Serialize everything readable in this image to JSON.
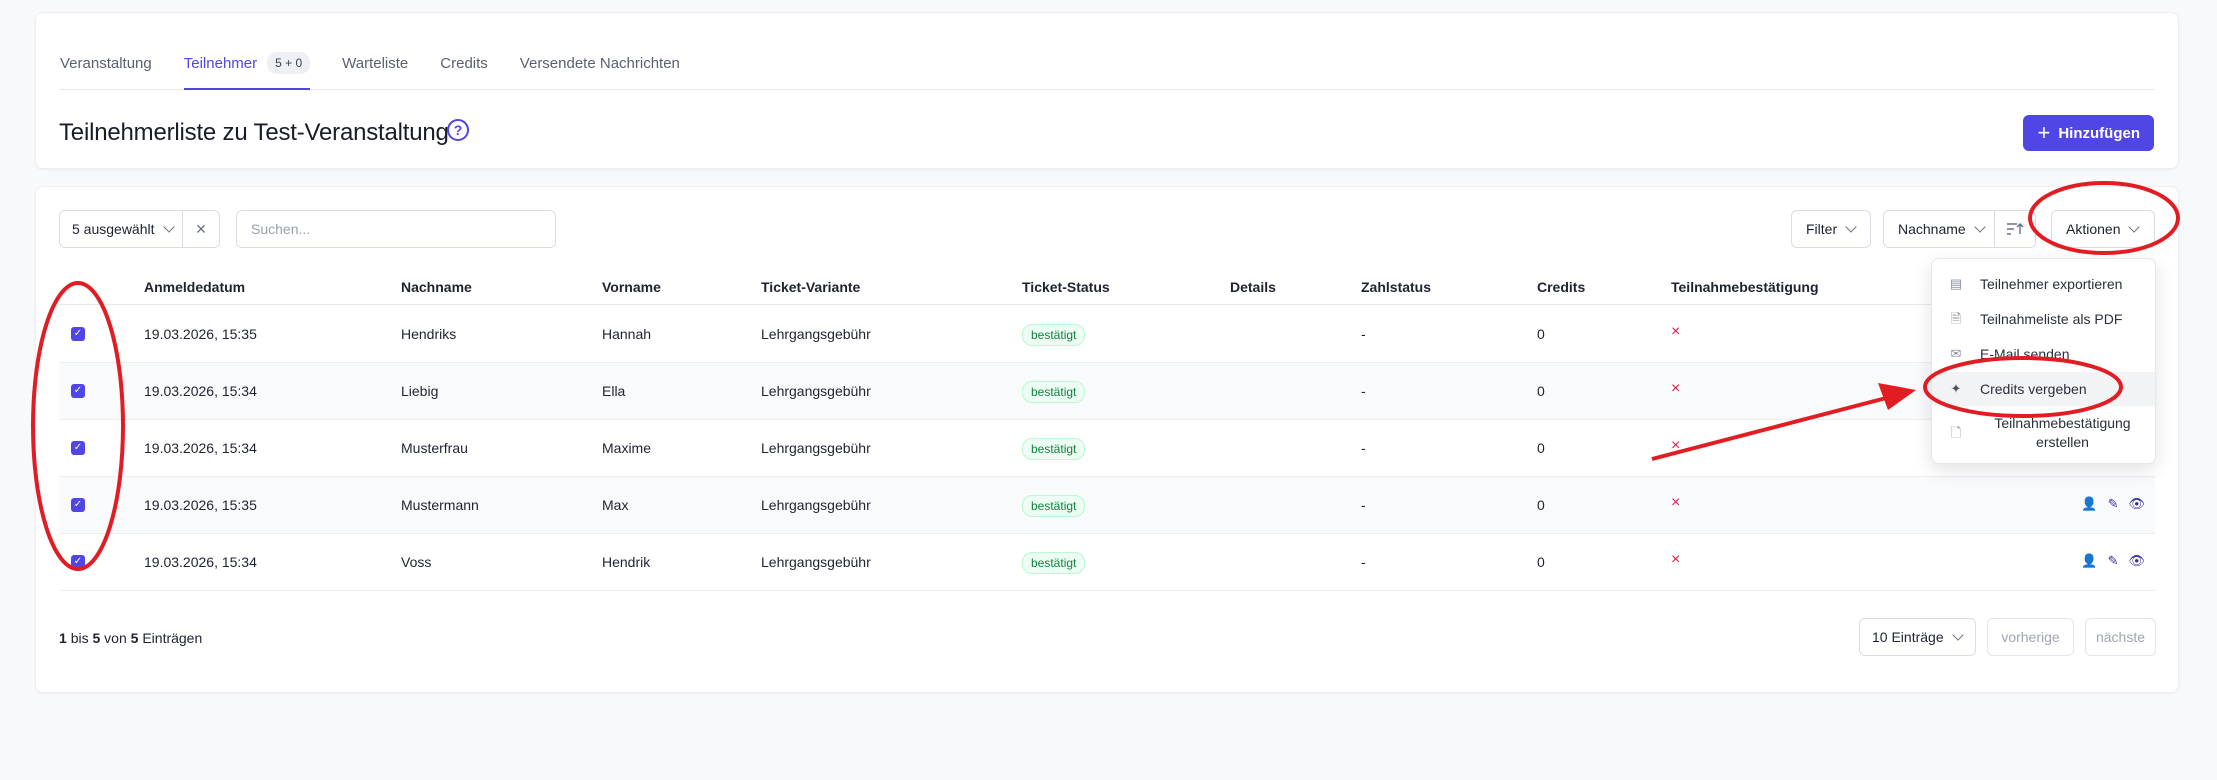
{
  "tabs": [
    {
      "label": "Veranstaltung"
    },
    {
      "label": "Teilnehmer",
      "badge": "5 + 0",
      "active": true
    },
    {
      "label": "Warteliste"
    },
    {
      "label": "Credits"
    },
    {
      "label": "Versendete Nachrichten"
    }
  ],
  "header": {
    "title": "Teilnehmerliste zu Test-Veranstaltung",
    "help_icon": "?",
    "add_button": "Hinzufügen"
  },
  "toolbar": {
    "selected": "5 ausgewählt",
    "search_placeholder": "Suchen...",
    "filter": "Filter",
    "sort": "Nachname",
    "actions": "Aktionen"
  },
  "table": {
    "columns": [
      "Anmeldedatum",
      "Nachname",
      "Vorname",
      "Ticket-Variante",
      "Ticket-Status",
      "Details",
      "Zahlstatus",
      "Credits",
      "Teilnahmebestätigung"
    ],
    "rows": [
      {
        "date": "19.03.2026, 15:35",
        "last": "Hendriks",
        "first": "Hannah",
        "ticket": "Lehrgangsgebühr",
        "status": "bestätigt",
        "pay": "-",
        "credits": "0",
        "confirm": "×"
      },
      {
        "date": "19.03.2026, 15:34",
        "last": "Liebig",
        "first": "Ella",
        "ticket": "Lehrgangsgebühr",
        "status": "bestätigt",
        "pay": "-",
        "credits": "0",
        "confirm": "×"
      },
      {
        "date": "19.03.2026, 15:34",
        "last": "Musterfrau",
        "first": "Maxime",
        "ticket": "Lehrgangsgebühr",
        "status": "bestätigt",
        "pay": "-",
        "credits": "0",
        "confirm": "×"
      },
      {
        "date": "19.03.2026, 15:35",
        "last": "Mustermann",
        "first": "Max",
        "ticket": "Lehrgangsgebühr",
        "status": "bestätigt",
        "pay": "-",
        "credits": "0",
        "confirm": "×"
      },
      {
        "date": "19.03.2026, 15:34",
        "last": "Voss",
        "first": "Hendrik",
        "ticket": "Lehrgangsgebühr",
        "status": "bestätigt",
        "pay": "-",
        "credits": "0",
        "confirm": "×"
      }
    ]
  },
  "footer": {
    "from": "1",
    "from_word": "bis",
    "to": "5",
    "of_word": "von",
    "total": "5",
    "entries_word": "Einträgen",
    "per_page": "10 Einträge",
    "prev": "vorherige",
    "next": "nächste"
  },
  "menu": {
    "items": [
      {
        "label": "Teilnehmer exportieren",
        "icon": "table-icon"
      },
      {
        "label": "Teilnahmeliste als PDF",
        "icon": "file-icon"
      },
      {
        "label": "E-Mail senden",
        "icon": "mail-icon"
      },
      {
        "label": "Credits vergeben",
        "icon": "sparkle-icon"
      },
      {
        "label": "Teilnahmebestätigung erstellen",
        "icon": "file-plus-icon"
      }
    ]
  },
  "colors": {
    "accent": "#4f46e5",
    "annotation": "#e11d23",
    "success": "#15803d",
    "error": "#e11d48"
  }
}
